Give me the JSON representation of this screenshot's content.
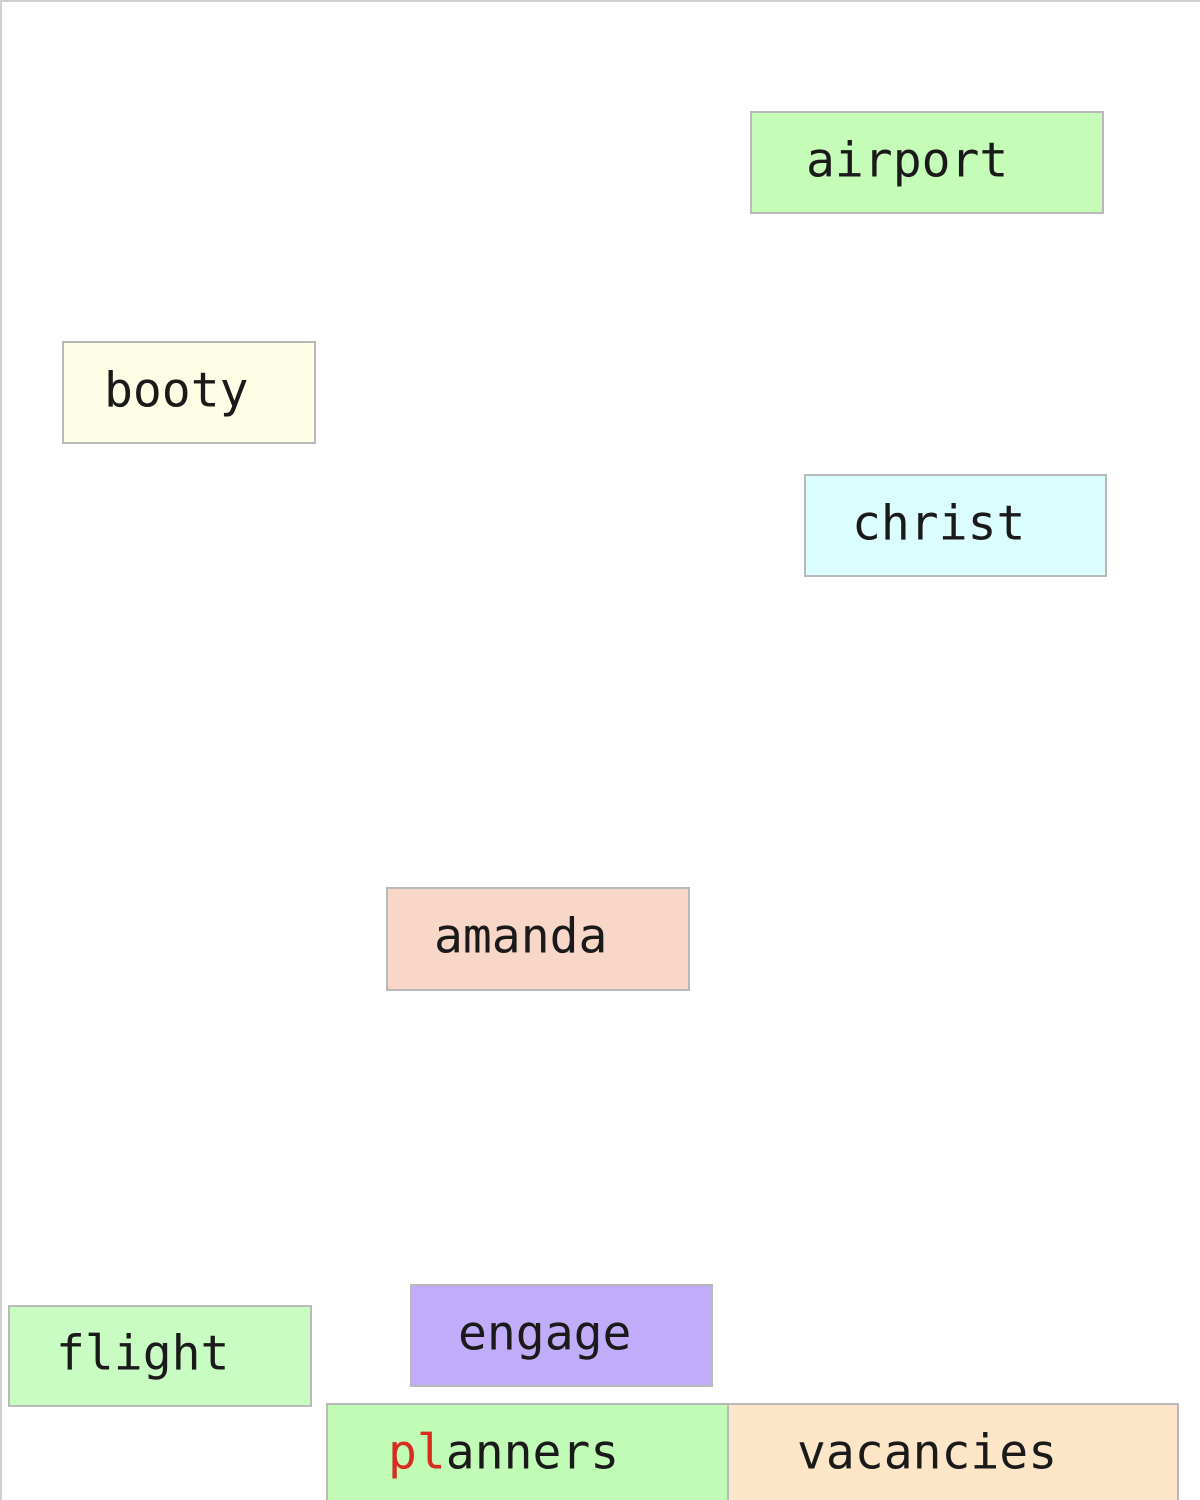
{
  "tiles": [
    {
      "id": "airport",
      "prefix": "",
      "rest": "airport",
      "color": "#c4fcb8"
    },
    {
      "id": "booty",
      "prefix": "",
      "rest": "booty",
      "color": "#fefde6"
    },
    {
      "id": "christ",
      "prefix": "",
      "rest": "christ",
      "color": "#dcfdfd"
    },
    {
      "id": "amanda",
      "prefix": "",
      "rest": "amanda",
      "color": "#f8d7c8"
    },
    {
      "id": "engage",
      "prefix": "",
      "rest": "engage",
      "color": "#c0acf8"
    },
    {
      "id": "flight",
      "prefix": "",
      "rest": "flight",
      "color": "#c9fcc2"
    },
    {
      "id": "planners",
      "prefix": "pl",
      "rest": "anners",
      "color": "#c0fcb6"
    },
    {
      "id": "vacancies",
      "prefix": "",
      "rest": "vacancies",
      "color": "#fde6c8"
    }
  ],
  "highlight_color": "#d62d20"
}
